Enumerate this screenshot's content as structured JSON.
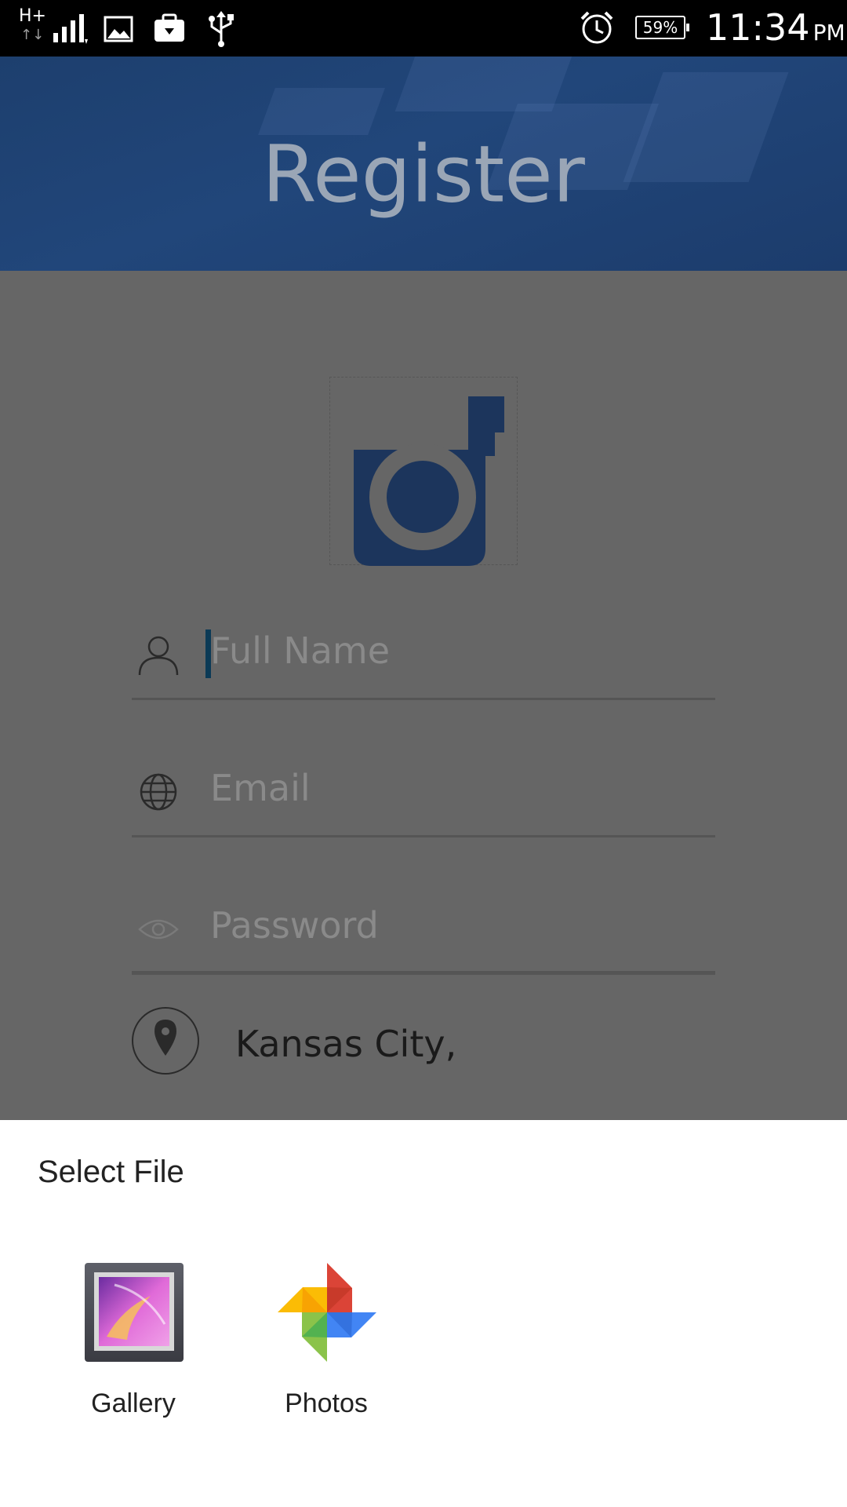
{
  "status_bar": {
    "network_type": "H+",
    "network_arrows": "↑↓",
    "battery": "59%",
    "time": "11:34",
    "ampm": "PM",
    "icons": [
      "signal-icon",
      "image-icon",
      "briefcase-icon",
      "usb-icon",
      "alarm-icon",
      "battery-icon"
    ]
  },
  "header": {
    "title": "Register"
  },
  "form": {
    "avatar_icon": "camera-icon",
    "full_name": {
      "placeholder": "Full Name",
      "icon": "person-icon"
    },
    "email": {
      "placeholder": "Email",
      "icon": "globe-icon"
    },
    "password": {
      "placeholder": "Password",
      "icon": "eye-icon"
    },
    "location": {
      "value": "Kansas City,",
      "icon": "location-pin-icon"
    }
  },
  "sheet": {
    "title": "Select File",
    "options": [
      {
        "label": "Gallery",
        "icon": "gallery-icon"
      },
      {
        "label": "Photos",
        "icon": "photos-icon"
      }
    ]
  },
  "colors": {
    "header_bg": "#21467a",
    "overlay": "#666666",
    "camera": "#1c355c",
    "cursor": "#0b3a56"
  }
}
